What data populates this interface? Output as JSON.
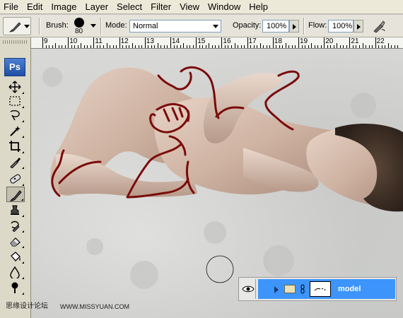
{
  "menu": [
    "File",
    "Edit",
    "Image",
    "Layer",
    "Select",
    "Filter",
    "View",
    "Window",
    "Help"
  ],
  "options": {
    "tool_icon": "brush-icon",
    "brush_label": "Brush:",
    "brush_size": "80",
    "mode_label": "Mode:",
    "mode_value": "Normal",
    "opacity_label": "Opacity:",
    "opacity_value": "100%",
    "flow_label": "Flow:",
    "flow_value": "100%",
    "airbrush_icon": "airbrush-icon"
  },
  "ruler": {
    "top_numbers": [
      "9",
      "10",
      "11",
      "12",
      "13",
      "14",
      "15",
      "16",
      "17",
      "18",
      "19",
      "20",
      "21",
      "22"
    ]
  },
  "toolbox": {
    "logo": "Ps",
    "tools": [
      "move-icon",
      "marquee-icon",
      "lasso-icon",
      "magic-wand-icon",
      "crop-icon",
      "eyedropper-icon",
      "healing-brush-icon",
      "brush-icon",
      "clone-stamp-icon",
      "history-brush-icon",
      "eraser-icon",
      "paint-bucket-icon",
      "blur-icon",
      "dodge-icon"
    ],
    "active_tool": "brush-icon"
  },
  "layers": {
    "name": "model",
    "visibility_icon": "eye-icon",
    "expand_icon": "expand-arrow-icon",
    "group_icon": "folder-icon",
    "link_icon": "chain-icon",
    "selection_color": "#3d95fb"
  },
  "brush_stroke_color": "#7a0b0b",
  "watermark": {
    "text": "思缘设计论坛",
    "url": "WWW.MISSYUAN.COM"
  }
}
